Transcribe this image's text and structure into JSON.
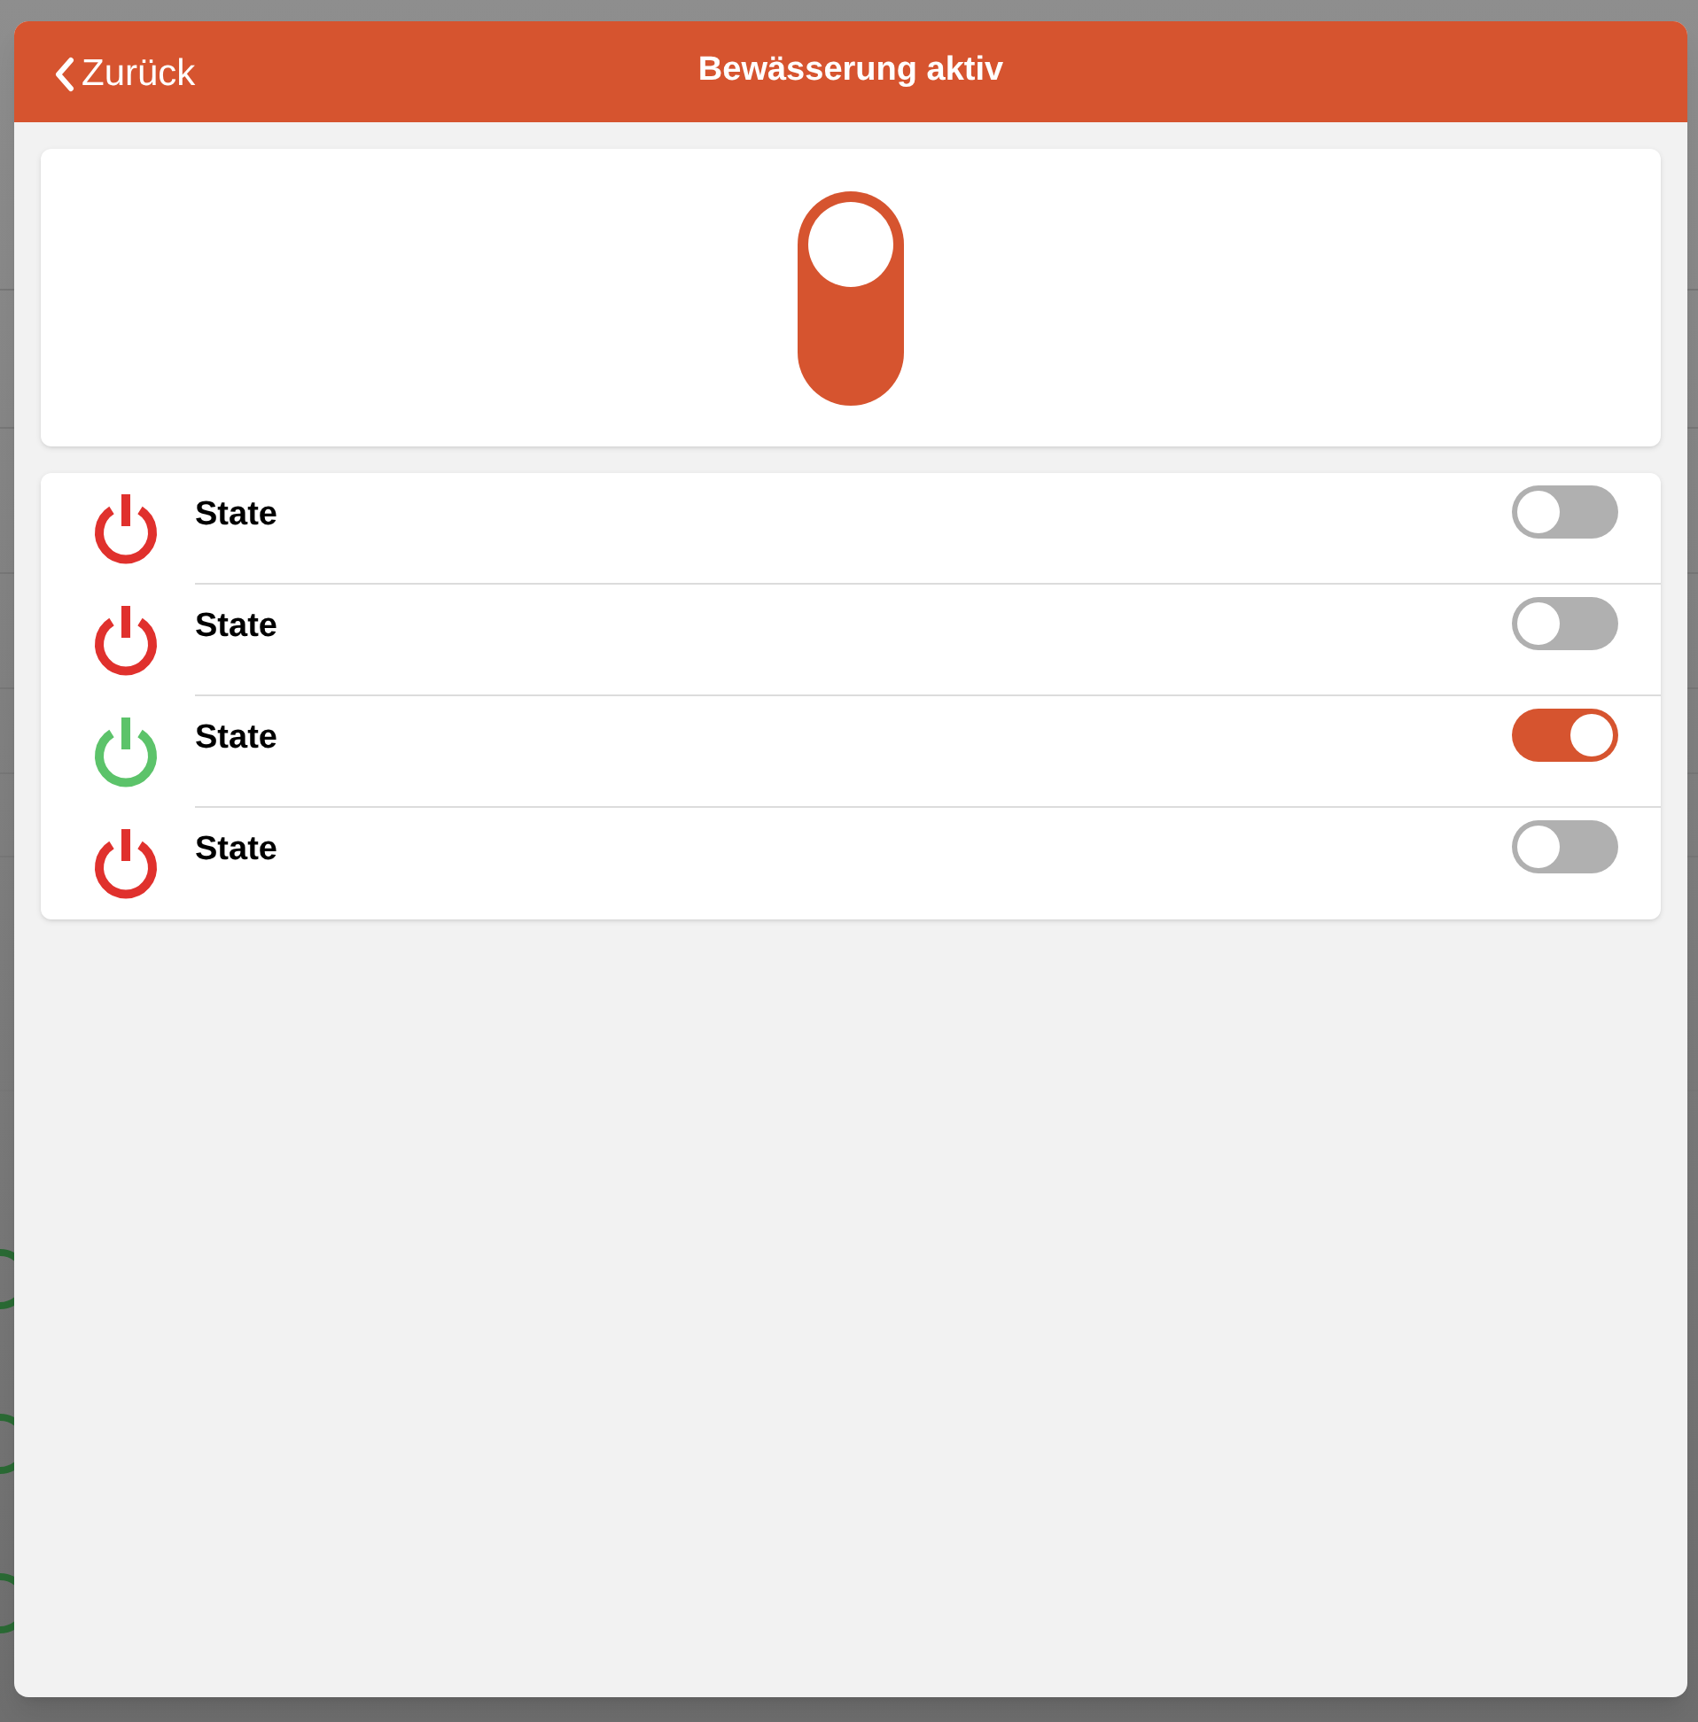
{
  "header": {
    "back_label": "Zurück",
    "title": "Bewässerung aktiv"
  },
  "main_switch": {
    "on": true
  },
  "states": [
    {
      "label": "State",
      "on": false
    },
    {
      "label": "State",
      "on": false
    },
    {
      "label": "State",
      "on": true
    },
    {
      "label": "State",
      "on": false
    }
  ]
}
